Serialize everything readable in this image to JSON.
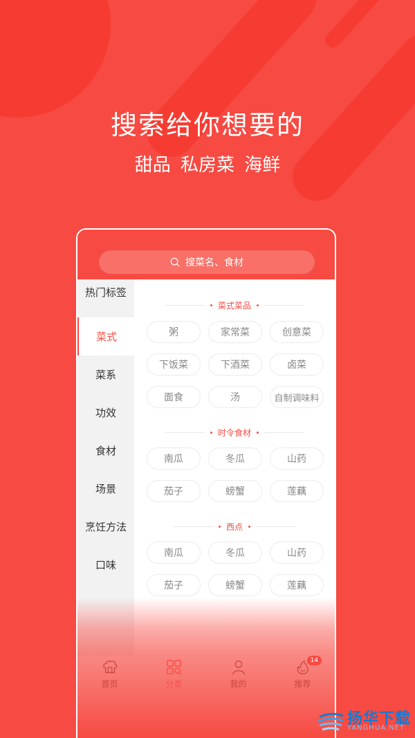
{
  "hero": {
    "headline": "搜索给你想要的",
    "subline": "甜品 私房菜 海鲜"
  },
  "search": {
    "icon": "search-icon",
    "placeholder": "搜菜名、食材"
  },
  "sidebar": {
    "items": [
      {
        "label": "热门标签",
        "active": false
      },
      {
        "label": "菜式",
        "active": true
      },
      {
        "label": "菜系",
        "active": false
      },
      {
        "label": "功效",
        "active": false
      },
      {
        "label": "食材",
        "active": false
      },
      {
        "label": "场景",
        "active": false
      },
      {
        "label": "烹饪方法",
        "active": false
      },
      {
        "label": "口味",
        "active": false
      }
    ]
  },
  "sections": [
    {
      "title": "菜式菜品",
      "tags": [
        "粥",
        "家常菜",
        "创意菜",
        "下饭菜",
        "下酒菜",
        "卤菜",
        "面食",
        "汤",
        "自制调味料"
      ]
    },
    {
      "title": "时令食材",
      "tags": [
        "南瓜",
        "冬瓜",
        "山药",
        "茄子",
        "螃蟹",
        "莲藕"
      ]
    },
    {
      "title": "西点",
      "tags": [
        "南瓜",
        "冬瓜",
        "山药",
        "茄子",
        "螃蟹",
        "莲藕"
      ]
    }
  ],
  "tabbar": {
    "items": [
      {
        "label": "首页",
        "icon": "home-icon",
        "active": false
      },
      {
        "label": "分类",
        "icon": "category-icon",
        "active": true
      },
      {
        "label": "我的",
        "icon": "user-icon",
        "active": false
      },
      {
        "label": "推荐",
        "icon": "flame-icon",
        "active": false,
        "badge": "14"
      }
    ]
  },
  "watermark": {
    "title": "扬华下载",
    "subtitle": "YANGHUA.NET"
  },
  "colors": {
    "brand": "#f64a42",
    "tag_text": "#888888"
  }
}
